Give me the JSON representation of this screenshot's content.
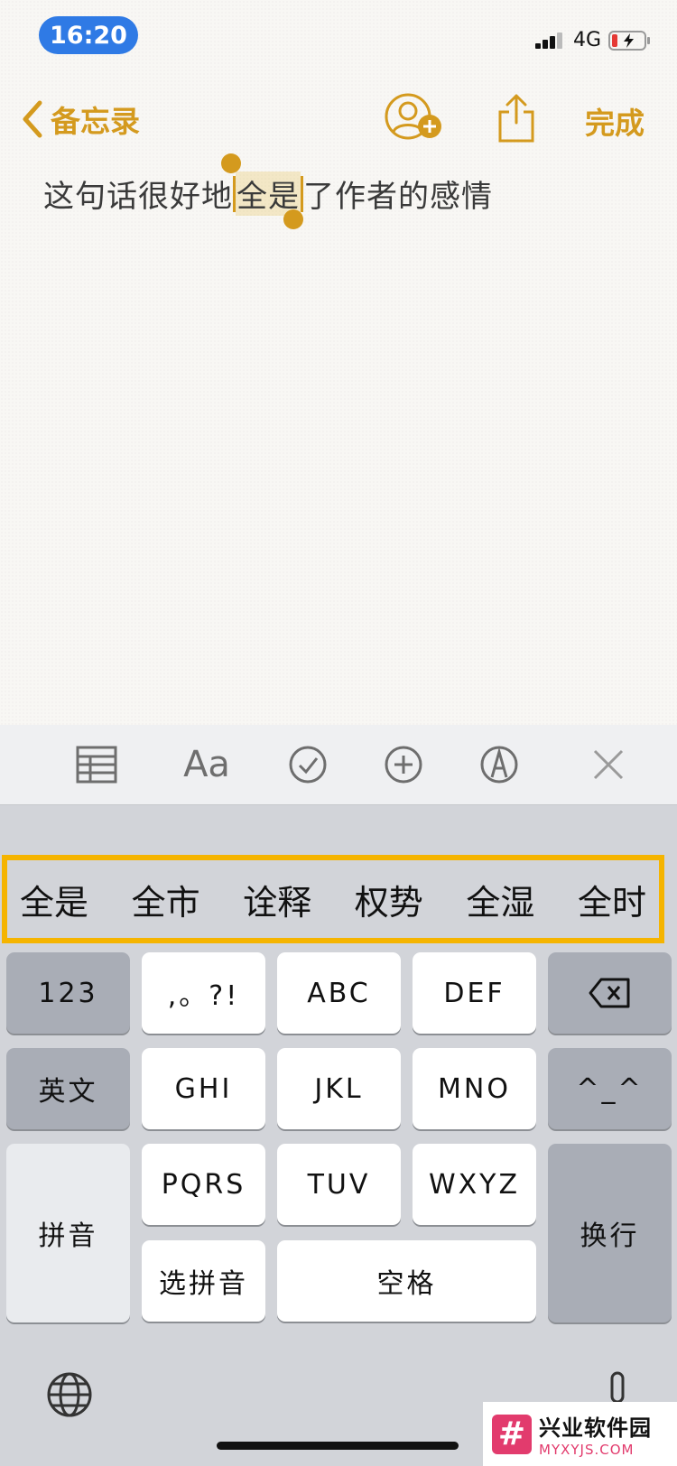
{
  "status_bar": {
    "time": "16:20",
    "network": "4G",
    "battery": "low-charging"
  },
  "nav": {
    "back_label": "备忘录",
    "done_label": "完成"
  },
  "note": {
    "before": "这句话很好地",
    "selected": "全是",
    "after": "了作者的感情"
  },
  "toolbar": {
    "icons": [
      "table-icon",
      "format-icon",
      "checklist-icon",
      "add-icon",
      "markup-icon",
      "close-icon"
    ],
    "format_label": "Aa"
  },
  "candidates": [
    "全是",
    "全市",
    "诠释",
    "权势",
    "全湿",
    "全时"
  ],
  "keys": {
    "num": "123",
    "punct": ",。?!",
    "abc": "ABC",
    "def": "DEF",
    "eng": "英文",
    "ghi": "GHI",
    "jkl": "JKL",
    "mno": "MNO",
    "emoji": "^_^",
    "pinyin": "拼音",
    "pqrs": "PQRS",
    "tuv": "TUV",
    "wxyz": "WXYZ",
    "enter": "换行",
    "choose_pinyin": "选拼音",
    "space": "空格"
  },
  "watermark": {
    "title": "兴业软件园",
    "url": "MYXYJS.COM"
  },
  "colors": {
    "accent": "#d49a1e",
    "highlight_box": "#f5b400",
    "time_pill": "#2f7ae5"
  }
}
